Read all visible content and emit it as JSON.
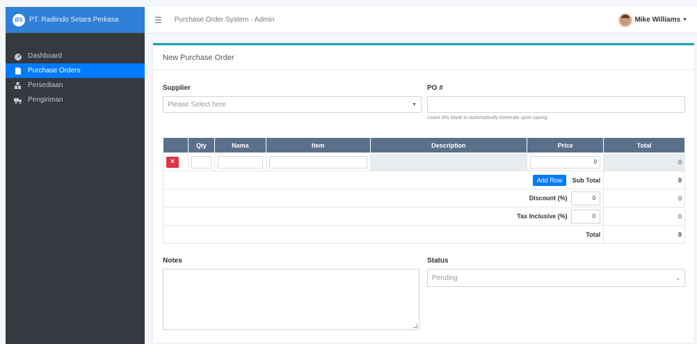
{
  "brand": {
    "logo": "BS",
    "name": "PT. Radiindo Setara Perkasa"
  },
  "nav": [
    {
      "label": "Dashboard",
      "icon": "dashboard-icon",
      "active": false
    },
    {
      "label": "Purchase Orders",
      "icon": "file-icon",
      "active": true
    },
    {
      "label": "Persediaan",
      "icon": "boxes-icon",
      "active": false
    },
    {
      "label": "Pengiriman",
      "icon": "truck-icon",
      "active": false
    }
  ],
  "topbar": {
    "title": "Purchase Order System - Admin",
    "user": "Mike Williams"
  },
  "card": {
    "title": "New Purchase Order"
  },
  "form": {
    "supplier_label": "Supplier",
    "supplier_placeholder": "Please Select here",
    "po_label": "PO #",
    "po_help": "Leave this blank to Automatically Generate upon saving.",
    "notes_label": "Notes",
    "status_label": "Status",
    "status_value": "Pending"
  },
  "table": {
    "headers": [
      "",
      "Qty",
      "Nama",
      "Item",
      "Description",
      "Price",
      "Total"
    ],
    "row": {
      "price": "0",
      "total": "0"
    },
    "add_row": "Add Row",
    "subtotal_label": "Sub Total",
    "subtotal_value": "0",
    "discount_label": "Discount (%)",
    "discount_input": "0",
    "discount_value": "0",
    "tax_label": "Tax Inclusive (%)",
    "tax_input": "0",
    "tax_value": "0",
    "total_label": "Total",
    "total_value": "0"
  },
  "colors": {
    "primary": "#007bff",
    "sidebar": "#343a40",
    "header": "#5a6f8a",
    "danger": "#dc3545",
    "accent": "#17a2b8"
  }
}
